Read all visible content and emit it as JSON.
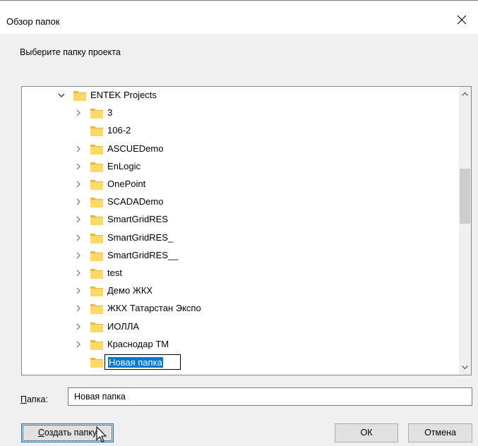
{
  "window": {
    "title": "Обзор папок"
  },
  "instruction": "Выберите папку проекта",
  "tree": {
    "root": {
      "label": "ENTEK Projects",
      "expanded": true
    },
    "items": [
      {
        "label": "3",
        "has_children": true
      },
      {
        "label": "106-2",
        "has_children": false
      },
      {
        "label": "ASCUEDemo",
        "has_children": true
      },
      {
        "label": "EnLogic",
        "has_children": true
      },
      {
        "label": "OnePoint",
        "has_children": true
      },
      {
        "label": "SCADADemo",
        "has_children": true
      },
      {
        "label": "SmartGridRES",
        "has_children": true
      },
      {
        "label": "SmartGridRES_",
        "has_children": true
      },
      {
        "label": "SmartGridRES__",
        "has_children": true
      },
      {
        "label": "test",
        "has_children": true
      },
      {
        "label": "Демо ЖКХ",
        "has_children": true
      },
      {
        "label": "ЖКХ Татарстан Экспо",
        "has_children": true
      },
      {
        "label": "ИОЛЛА",
        "has_children": true
      },
      {
        "label": "Краснодар ТМ",
        "has_children": true
      }
    ],
    "editing_item": {
      "value": "Новая папка"
    }
  },
  "folder_field": {
    "label_underlined": "П",
    "label_rest": "апка:",
    "value": "Новая папка"
  },
  "buttons": {
    "create_underlined": "С",
    "create_rest": "оздать папку",
    "ok": "ОК",
    "cancel": "Отмена"
  },
  "colors": {
    "folder_fill": "#ffd866",
    "folder_tab": "#e8b83a",
    "selection": "#0078d7",
    "accent_border": "#0078d7"
  },
  "icons": {
    "close": "close-icon",
    "expand": "chevron-right-icon",
    "collapse": "chevron-down-icon",
    "folder": "folder-icon"
  }
}
